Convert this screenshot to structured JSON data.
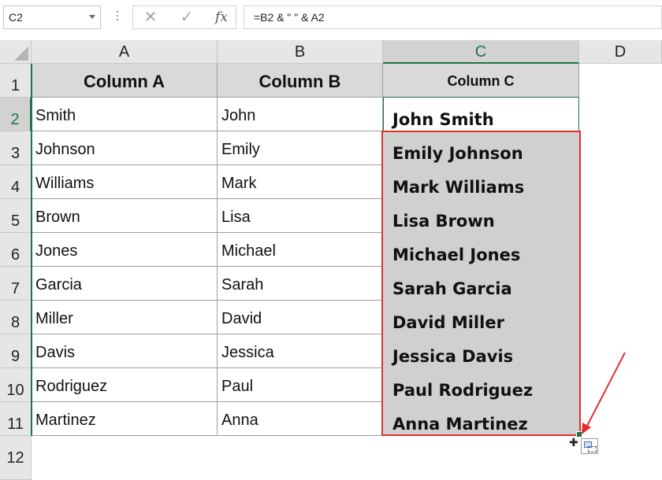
{
  "formula_bar": {
    "name_box": "C2",
    "cancel_icon": "✕",
    "enter_icon": "✓",
    "fx_label": "fx",
    "formula": "=B2 & \" \" & A2"
  },
  "columns": [
    "A",
    "B",
    "C",
    "D"
  ],
  "rows": [
    "1",
    "2",
    "3",
    "4",
    "5",
    "6",
    "7",
    "8",
    "9",
    "10",
    "11",
    "12"
  ],
  "header_row": {
    "a": "Column A",
    "b": "Column B",
    "c": "Column C"
  },
  "data_rows": [
    {
      "a": "Smith",
      "b": "John",
      "c": "John Smith"
    },
    {
      "a": "Johnson",
      "b": "Emily",
      "c": "Emily Johnson"
    },
    {
      "a": "Williams",
      "b": "Mark",
      "c": "Mark Williams"
    },
    {
      "a": "Brown",
      "b": "Lisa",
      "c": "Lisa Brown"
    },
    {
      "a": "Jones",
      "b": "Michael",
      "c": "Michael Jones"
    },
    {
      "a": "Garcia",
      "b": "Sarah",
      "c": "Sarah Garcia"
    },
    {
      "a": "Miller",
      "b": "David",
      "c": "David Miller"
    },
    {
      "a": "Davis",
      "b": "Jessica",
      "c": "Jessica Davis"
    },
    {
      "a": "Rodriguez",
      "b": "Paul",
      "c": "Paul Rodriguez"
    },
    {
      "a": "Martinez",
      "b": "Anna",
      "c": "Anna Martinez"
    }
  ],
  "colors": {
    "selection_green": "#217346",
    "highlight_red": "#e03030",
    "header_fill": "#d9d9d9",
    "fill_shade": "#d0d0d0"
  },
  "icons": {
    "autofill_options": "autofill-options-icon",
    "cursor": "crosshair-cursor-icon"
  }
}
